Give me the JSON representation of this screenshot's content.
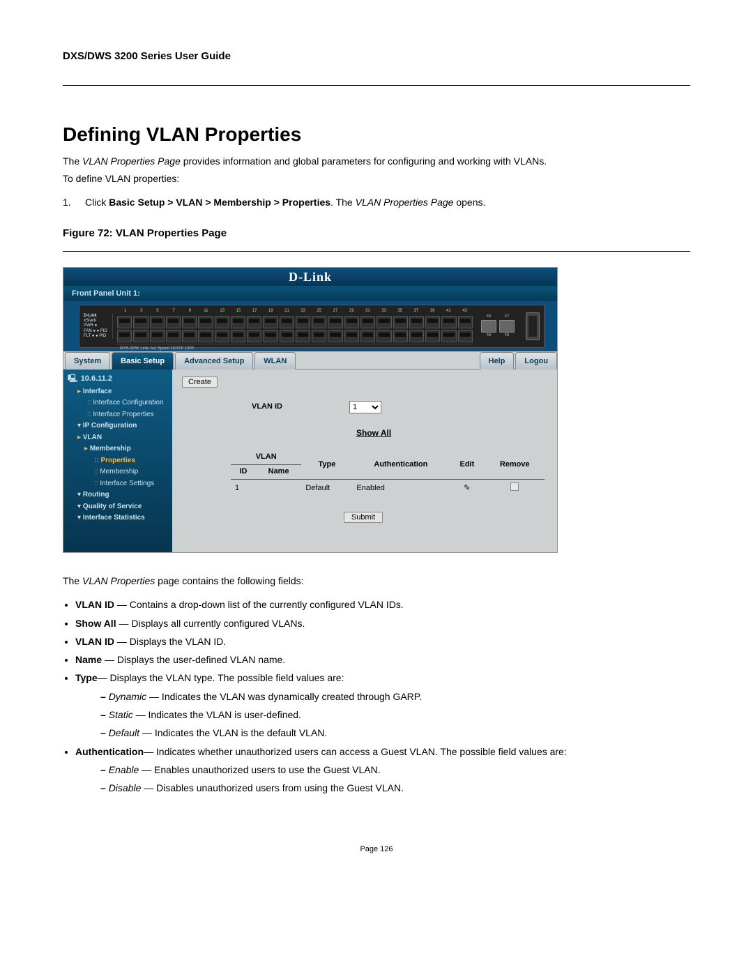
{
  "header": {
    "doc_title": "DXS/DWS 3200 Series User Guide"
  },
  "section": {
    "heading": "Defining VLAN Properties",
    "intro_line1_prefix": "The ",
    "intro_line1_em": "VLAN Properties Page",
    "intro_line1_suffix": " provides information and global parameters for configuring and working with VLANs.",
    "intro_line2": "To define VLAN properties:",
    "step_num": "1.",
    "step_prefix": "Click ",
    "step_bold": "Basic Setup > VLAN > Membership > Properties",
    "step_mid": ". The ",
    "step_em": "VLAN Properties Page",
    "step_suffix": " opens.",
    "figure_caption": "Figure 72:  VLAN Properties Page"
  },
  "screenshot": {
    "brand": "D-Link",
    "front_panel": "Front Panel Unit 1:",
    "device": {
      "name": "D-Link",
      "model_line": "DXS-3250   Link/   Act  Speed   10/100  1000",
      "pwr": "PWR ●",
      "xstack": "xStack",
      "fan": "FAN ● ● PID",
      "flt": "FLT ● ● PID",
      "sfp_top": [
        "45",
        "47"
      ],
      "sfp_bottom": [
        "46",
        "48"
      ]
    },
    "tabs": {
      "system": "System",
      "basic": "Basic Setup",
      "advanced": "Advanced Setup",
      "wlan": "WLAN",
      "help": "Help",
      "logout": "Logou"
    },
    "nav": {
      "root": "10.6.11.2",
      "items": [
        "Interface",
        "Interface Configuration",
        "Interface Properties",
        "IP Configuration",
        "VLAN",
        "Membership",
        "Properties",
        "Membership",
        "Interface Settings",
        "Routing",
        "Quality of Service",
        "Interface Statistics"
      ]
    },
    "main": {
      "create": "Create",
      "vlan_id_label": "VLAN ID",
      "vlan_id_value": "1",
      "show_all": "Show All",
      "table": {
        "headers": [
          "ID",
          "Name",
          "Type",
          "Authentication",
          "Edit",
          "Remove"
        ],
        "vlan_group_header": "VLAN",
        "row": {
          "id": "1",
          "name": "",
          "type": "Default",
          "auth": "Enabled"
        }
      },
      "submit": "Submit"
    }
  },
  "body": {
    "after_prefix": "The ",
    "after_em": "VLAN Properties",
    "after_suffix": " page contains the following fields:",
    "fields": [
      {
        "label": "VLAN ID",
        "desc": " — Contains a drop-down list of the currently configured VLAN IDs."
      },
      {
        "label": "Show All",
        "desc": " — Displays all currently configured VLANs."
      },
      {
        "label": "VLAN ID",
        "desc": " — Displays the VLAN ID."
      },
      {
        "label": "Name",
        "desc": " — Displays the user-defined VLAN name."
      },
      {
        "label": "Type",
        "desc": "— Displays the VLAN type. The possible field values are:",
        "sub": [
          {
            "em": "Dynamic",
            "desc": " — Indicates the VLAN was dynamically created through GARP."
          },
          {
            "em": "Static",
            "desc": " — Indicates the VLAN is user-defined."
          },
          {
            "em": "Default",
            "desc": " — Indicates the VLAN is the default VLAN."
          }
        ]
      },
      {
        "label": "Authentication",
        "desc": "— Indicates whether unauthorized users can access a Guest VLAN. The possible field values are:",
        "sub": [
          {
            "em": "Enable",
            "desc": " — Enables unauthorized users to use the Guest VLAN."
          },
          {
            "em": "Disable",
            "desc": " — Disables unauthorized users from using the Guest VLAN."
          }
        ]
      }
    ]
  },
  "footer": {
    "page_num": "Page 126"
  }
}
